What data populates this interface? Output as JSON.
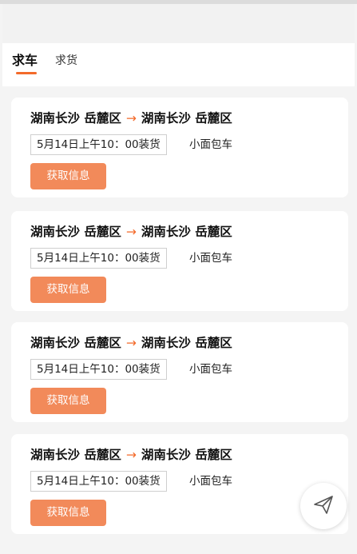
{
  "tabs": [
    {
      "label": "求车",
      "active": true
    },
    {
      "label": "求货",
      "active": false
    }
  ],
  "cards": [
    {
      "from": "湖南长沙 岳麓区",
      "arrow": "→",
      "to": "湖南长沙 岳麓区",
      "time": "5月14日上午10：00装货",
      "vehicle": "小面包车",
      "button": "获取信息"
    },
    {
      "from": "湖南长沙 岳麓区",
      "arrow": "→",
      "to": "湖南长沙 岳麓区",
      "time": "5月14日上午10：00装货",
      "vehicle": "小面包车",
      "button": "获取信息"
    },
    {
      "from": "湖南长沙 岳麓区",
      "arrow": "→",
      "to": "湖南长沙 岳麓区",
      "time": "5月14日上午10：00装货",
      "vehicle": "小面包车",
      "button": "获取信息"
    },
    {
      "from": "湖南长沙 岳麓区",
      "arrow": "→",
      "to": "湖南长沙 岳麓区",
      "time": "5月14日上午10：00装货",
      "vehicle": "小面包车",
      "button": "获取信息"
    }
  ],
  "floating_action": {
    "icon": "send-icon"
  },
  "colors": {
    "accent": "#f36a2a",
    "button": "#f28a5a"
  }
}
